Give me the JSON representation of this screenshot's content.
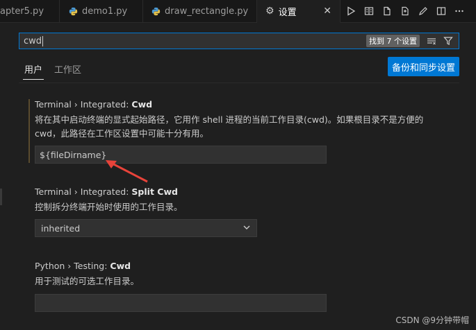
{
  "tabs": [
    {
      "label": "apter5.py"
    },
    {
      "label": "demo1.py"
    },
    {
      "label": "draw_rectangle.py"
    },
    {
      "label": "设置"
    }
  ],
  "search": {
    "value": "cwd",
    "results_badge": "找到 7 个设置"
  },
  "scopes": {
    "user": "用户",
    "workspace": "工作区",
    "sync_button": "备份和同步设置"
  },
  "settings": [
    {
      "category": "Terminal › Integrated: ",
      "key": "Cwd",
      "description": "将在其中启动终端的显式起始路径，它用作 shell 进程的当前工作目录(cwd)。如果根目录不是方便的 cwd，此路径在工作区设置中可能十分有用。",
      "value": "${fileDirname}"
    },
    {
      "category": "Terminal › Integrated: ",
      "key": "Split Cwd",
      "description": "控制拆分终端开始时使用的工作目录。",
      "value": "inherited"
    },
    {
      "category": "Python › Testing: ",
      "key": "Cwd",
      "description": "用于测试的可选工作目录。",
      "value": ""
    }
  ],
  "watermark": "CSDN @9分钟带帽",
  "colors": {
    "accent": "#0078d4",
    "annotation_arrow": "#e8433a",
    "python_icon": "#4c9bd6"
  },
  "icons": [
    "python-icon",
    "gear-icon",
    "close-icon",
    "run-icon",
    "open-preview-icon",
    "new-file-icon",
    "compare-icon",
    "pen-icon",
    "split-editor-icon",
    "more-icon",
    "clear-filter-icon",
    "filter-icon",
    "chevron-down-icon"
  ]
}
